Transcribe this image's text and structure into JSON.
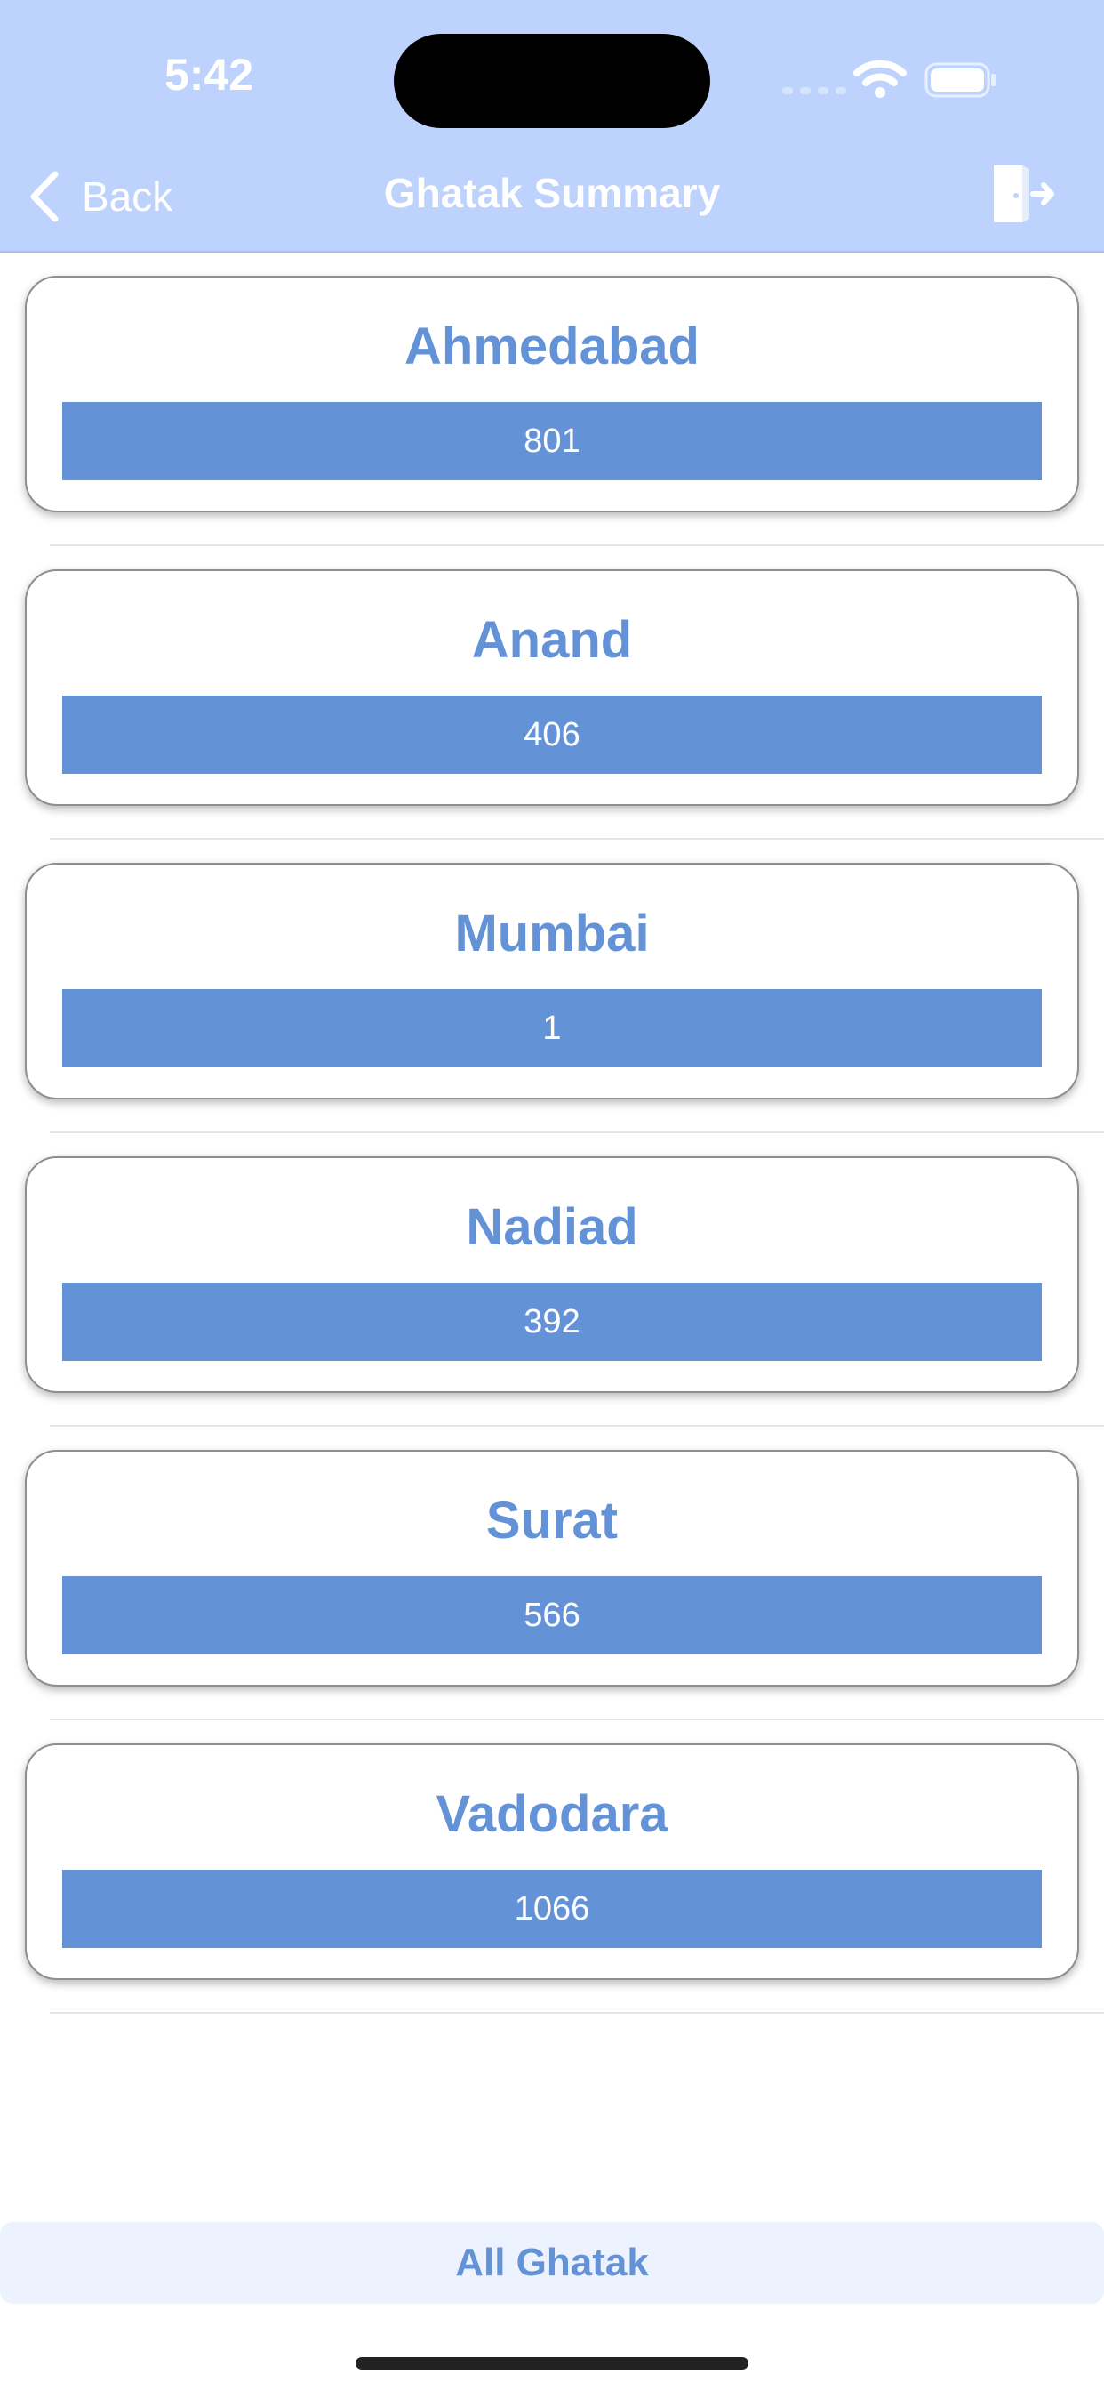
{
  "status_bar": {
    "time": "5:42"
  },
  "nav": {
    "back_label": "Back",
    "title": "Ghatak Summary",
    "logout_icon": "logout-door-icon"
  },
  "cities": [
    {
      "name": "Ahmedabad",
      "count": "801"
    },
    {
      "name": "Anand",
      "count": "406"
    },
    {
      "name": "Mumbai",
      "count": "1"
    },
    {
      "name": "Nadiad",
      "count": "392"
    },
    {
      "name": "Surat",
      "count": "566"
    },
    {
      "name": "Vadodara",
      "count": "1066"
    }
  ],
  "footer": {
    "all_button_label": "All Ghatak"
  },
  "colors": {
    "header_bg": "#bdd3fd",
    "accent": "#6492d6",
    "footer_bg": "#ecf3fe"
  }
}
